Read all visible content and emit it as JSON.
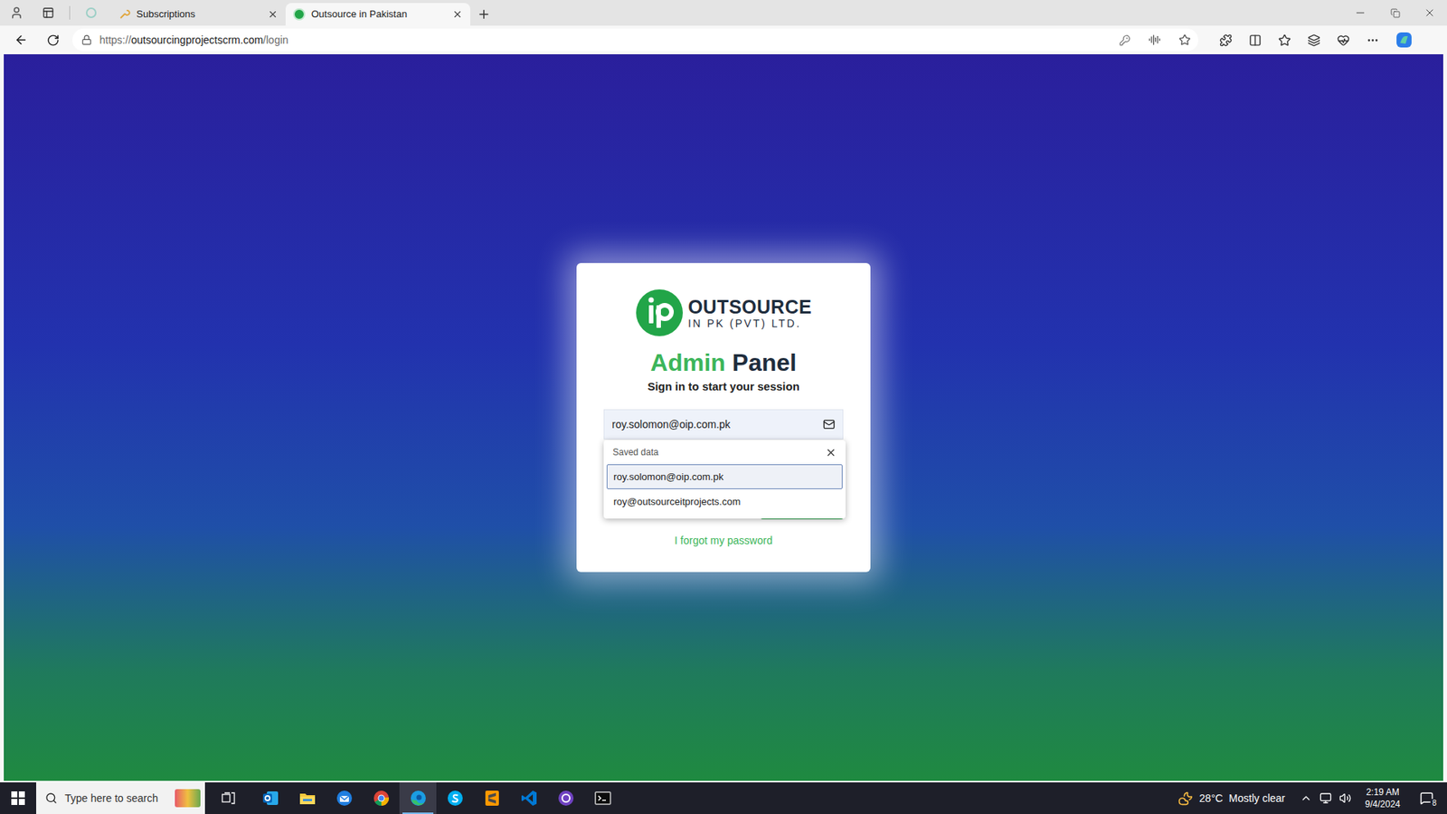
{
  "browser": {
    "tabs": [
      {
        "label": "Subscriptions",
        "selected": false
      },
      {
        "label": "Outsource in Pakistan",
        "selected": true
      }
    ],
    "address": {
      "scheme": "https://",
      "host": "outsourcingprojectscrm.com",
      "path": "/login"
    }
  },
  "login": {
    "logo": {
      "name": "OUTSOURCE",
      "tagline": "IN PK (PVT) LTD."
    },
    "title": {
      "accent": "Admin",
      "rest": "Panel"
    },
    "subtitle": "Sign in to start your session",
    "email": {
      "value": "roy.solomon@oip.com.pk"
    },
    "autofill": {
      "header": "Saved data",
      "items": [
        {
          "text": "roy.solomon@oip.com.pk",
          "selected": true
        },
        {
          "text": "roy@outsourceitprojects.com",
          "selected": false
        }
      ]
    },
    "forgot": "I forgot my password"
  },
  "taskbar": {
    "search": {
      "placeholder": "Type here to search"
    },
    "apps": [
      {
        "kind": "outlook",
        "active": false
      },
      {
        "kind": "explorer",
        "active": false
      },
      {
        "kind": "thunderbird",
        "active": false
      },
      {
        "kind": "chrome",
        "active": false
      },
      {
        "kind": "edge",
        "active": true
      },
      {
        "kind": "skype",
        "active": false
      },
      {
        "kind": "sublime",
        "active": false
      },
      {
        "kind": "vscode",
        "active": false
      },
      {
        "kind": "github",
        "active": false
      },
      {
        "kind": "terminal",
        "active": false
      }
    ],
    "weather": {
      "temp": "28°C",
      "condition": "Mostly clear"
    },
    "clock": {
      "time": "2:19 AM",
      "date": "9/4/2024"
    },
    "notifications": {
      "count": "8"
    }
  }
}
